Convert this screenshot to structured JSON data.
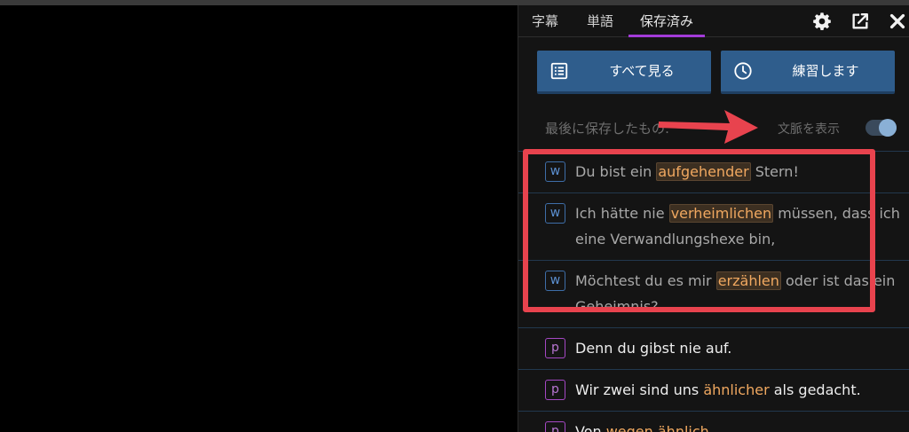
{
  "tabs": [
    {
      "label": "字幕"
    },
    {
      "label": "単語"
    },
    {
      "label": "保存済み"
    }
  ],
  "header_icons": [
    "gear-icon",
    "export-icon",
    "close-icon"
  ],
  "buttons": {
    "see_all": "すべて見る",
    "practice": "練習します"
  },
  "last_saved_label": "最後に保存したもの:",
  "context_label": "文脈を表示",
  "context_toggle_on": true,
  "items": [
    {
      "badge": "w",
      "pre": "Du bist ein ",
      "hl": "aufgehender",
      "post": " Stern!",
      "dim": true
    },
    {
      "badge": "w",
      "pre": "Ich hätte nie ",
      "hl": "verheimlichen",
      "post": " müssen, dass ich eine Verwandlungshexe bin,",
      "dim": true
    },
    {
      "badge": "w",
      "pre": "Möchtest du es mir ",
      "hl": "erzählen",
      "post": " oder ist das ein Geheimnis?",
      "dim": true
    },
    {
      "badge": "p",
      "pre": "Denn du gibst nie auf.",
      "hl": "",
      "post": "",
      "dim": false
    },
    {
      "badge": "p",
      "pre": "Wir zwei sind uns ",
      "hl": "ähnlicher",
      "post": " als gedacht.",
      "dim": false
    },
    {
      "badge": "p",
      "pre": "Von ",
      "hl": "wegen ähnlich",
      "post": ".",
      "dim": false
    }
  ],
  "colors": {
    "accent_tab": "#a33bd8",
    "button_blue": "#2f5d8c",
    "highlight": "#f0a860",
    "annotation_red": "#e8434e"
  }
}
